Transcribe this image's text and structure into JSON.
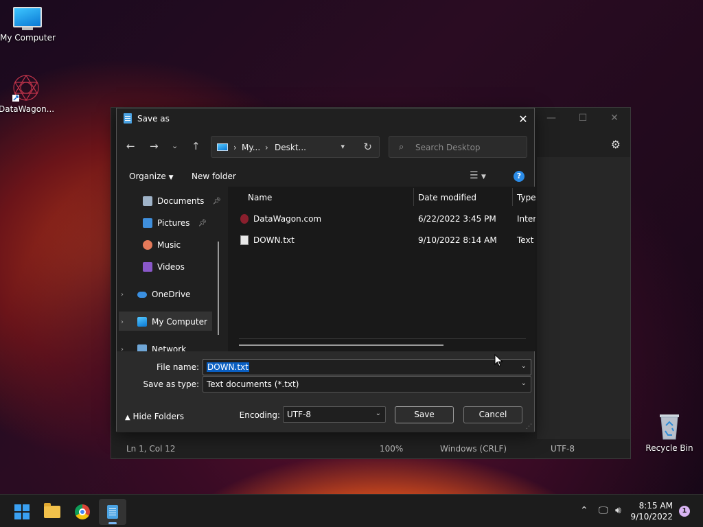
{
  "desktop": {
    "my_computer": "My Computer",
    "datawagon": "DataWagon...",
    "recycle_bin": "Recycle Bin"
  },
  "notepad": {
    "status": {
      "position": "Ln 1, Col 12",
      "zoom": "100%",
      "line_endings": "Windows (CRLF)",
      "encoding": "UTF-8"
    }
  },
  "dialog": {
    "title": "Save as",
    "address": {
      "crumb1": "My...",
      "crumb2": "Deskt..."
    },
    "search": {
      "placeholder": "Search Desktop"
    },
    "toolbar": {
      "organize": "Organize",
      "new_folder": "New folder"
    },
    "nav": {
      "documents": "Documents",
      "pictures": "Pictures",
      "music": "Music",
      "videos": "Videos",
      "onedrive": "OneDrive",
      "my_computer": "My Computer",
      "network": "Network"
    },
    "columns": {
      "name": "Name",
      "date": "Date modified",
      "type": "Type"
    },
    "files": [
      {
        "name": "DataWagon.com",
        "date": "6/22/2022 3:45 PM",
        "type": "Intern"
      },
      {
        "name": "DOWN.txt",
        "date": "9/10/2022 8:14 AM",
        "type": "Text D"
      }
    ],
    "file_name_label": "File name:",
    "file_name_value": "DOWN.txt",
    "save_type_label": "Save as type:",
    "save_type_value": "Text documents (*.txt)",
    "encoding_label": "Encoding:",
    "encoding_value": "UTF-8",
    "save_button": "Save",
    "cancel_button": "Cancel",
    "hide_folders": "Hide Folders"
  },
  "taskbar": {
    "time": "8:15 AM",
    "date": "9/10/2022",
    "notification_count": "1"
  },
  "colors": {
    "accent": "#0a5fc2",
    "help": "#2b8be6"
  }
}
